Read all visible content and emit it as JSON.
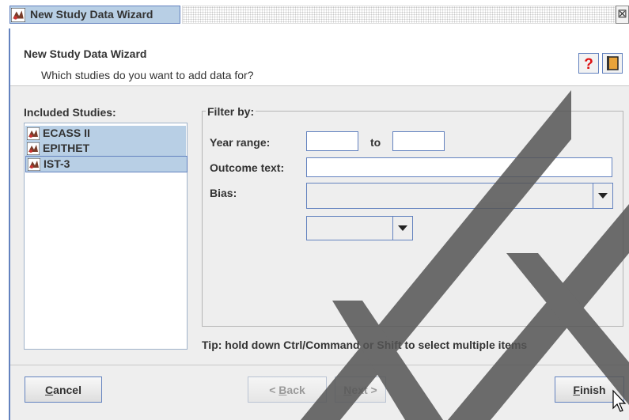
{
  "window": {
    "title": "New Study Data Wizard",
    "close_glyph": "⊠"
  },
  "header": {
    "heading": "New Study Data Wizard",
    "question": "Which studies do you want to add data for?",
    "help_icon": "help-question-icon",
    "book_icon": "book-icon"
  },
  "studies": {
    "label": "Included Studies:",
    "items": [
      {
        "label": "ECASS II"
      },
      {
        "label": "EPITHET"
      },
      {
        "label": "IST-3"
      }
    ]
  },
  "filter": {
    "group_label": "Filter by:",
    "year_range_label": "Year range:",
    "to_label": "to",
    "year_from": "",
    "year_to": "",
    "outcome_label": "Outcome text:",
    "outcome_value": "",
    "bias_label": "Bias:",
    "bias_value": "",
    "sub_value": ""
  },
  "tip": "Tip: hold down Ctrl/Command or Shift to select multiple items",
  "buttons": {
    "cancel_mnemonic": "C",
    "cancel_rest": "ancel",
    "back_prefix": "< ",
    "back_mnemonic": "B",
    "back_rest": "ack",
    "next_mnemonic": "N",
    "next_rest": "ext >",
    "finish_mnemonic": "F",
    "finish_rest": "inish"
  },
  "colors": {
    "accent": "#6382bf",
    "selection": "#b8cfe5",
    "watermark": "#444444"
  }
}
